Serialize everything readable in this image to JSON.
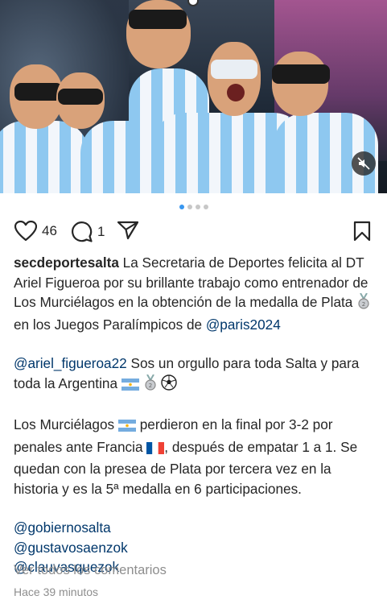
{
  "post": {
    "likes": "46",
    "comments": "1",
    "carousel": {
      "count": 4,
      "active_index": 0
    },
    "author": "secdeportesalta",
    "caption": {
      "p1": " La Secretaria de Deportes felicita al DT Ariel Figueroa por su brillante trabajo como entrenador de Los Murciélagos en la obtención de la medalla de Plata ",
      "p1_mid": " en los Juegos Paralímpicos de ",
      "p1_mention": "@paris2024",
      "p2_mention": "@ariel_figueroa22",
      "p2_text": " Sos un orgullo para toda Salta y para toda la Argentina ",
      "p3_a": "Los Murciélagos ",
      "p3_b": " perdieron en la final por 3-2 por penales ante Francia ",
      "p3_c": ", después de empatar 1 a 1. Se quedan con la presea de Plata por tercera vez en la historia y  es la 5ª medalla en 6 participaciones.",
      "mentions": [
        "@gobiernosalta",
        "@gustavosaenzok",
        "@clauvasquezok"
      ]
    },
    "view_all_comments": "Ver todos los comentarios",
    "timestamp": "Hace 39 minutos"
  },
  "icons": {
    "like": "heart-outline-icon",
    "comment": "speech-bubble-icon",
    "share": "paper-plane-icon",
    "save": "bookmark-outline-icon",
    "mute": "speaker-muted-icon"
  },
  "colors": {
    "text": "#262626",
    "mention": "#00376b",
    "muted": "#8e8e8e",
    "carousel_active": "#3897f0"
  }
}
